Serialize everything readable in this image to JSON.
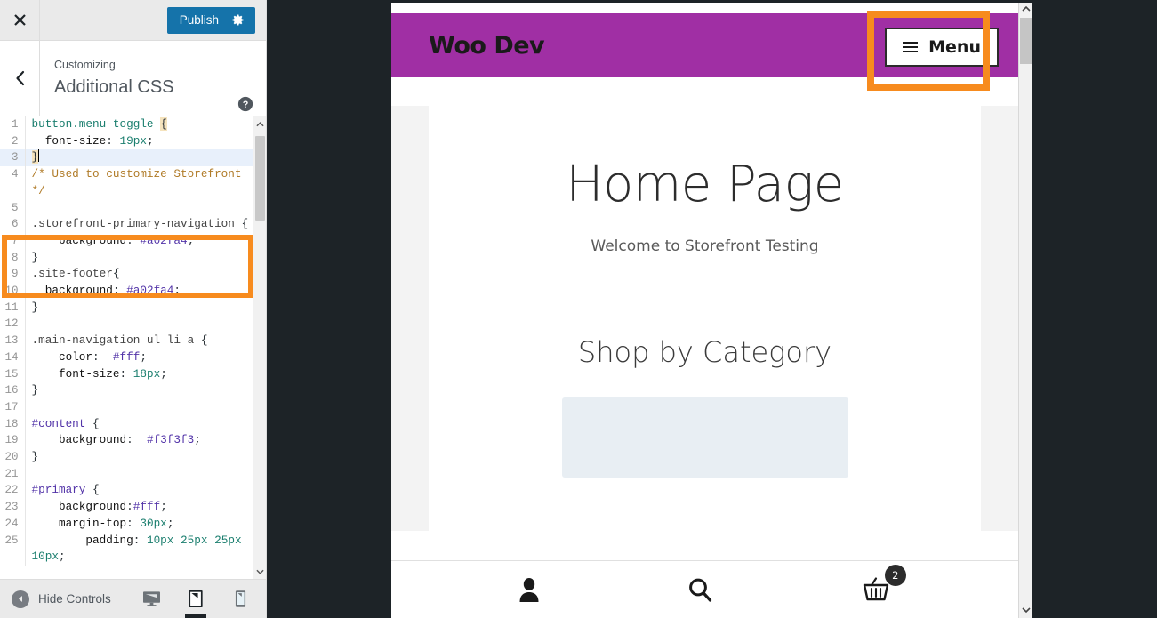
{
  "customizer": {
    "close_icon": "close-x-icon",
    "publish_label": "Publish",
    "gear_icon": "gear-icon",
    "back_icon": "chevron-left-icon",
    "breadcrumb": "Customizing",
    "panel_title": "Additional CSS",
    "help_icon": "help-circle-icon",
    "footer": {
      "hide_controls_label": "Hide Controls",
      "collapse_icon": "collapse-arrow-icon",
      "devices": [
        {
          "name": "desktop-preview",
          "icon": "desktop-icon",
          "active": false
        },
        {
          "name": "tablet-preview",
          "icon": "tablet-icon",
          "active": true
        },
        {
          "name": "mobile-preview",
          "icon": "mobile-icon",
          "active": false
        }
      ]
    }
  },
  "editor": {
    "lines": [
      {
        "n": "1",
        "text": "button.menu-toggle {"
      },
      {
        "n": "2",
        "text": "  font-size: 19px;"
      },
      {
        "n": "3",
        "text": "}"
      },
      {
        "n": "4",
        "text": "/* Used to customize Storefront*/"
      },
      {
        "n": "5",
        "text": ""
      },
      {
        "n": "6",
        "text": ".storefront-primary-navigation {"
      },
      {
        "n": "7",
        "text": "    background: #a02fa4;"
      },
      {
        "n": "8",
        "text": "}"
      },
      {
        "n": "9",
        "text": ".site-footer{"
      },
      {
        "n": "10",
        "text": "  background: #a02fa4;"
      },
      {
        "n": "11",
        "text": "}"
      },
      {
        "n": "12",
        "text": ""
      },
      {
        "n": "13",
        "text": ".main-navigation ul li a {"
      },
      {
        "n": "14",
        "text": "    color:  #fff;"
      },
      {
        "n": "15",
        "text": "    font-size: 18px;"
      },
      {
        "n": "16",
        "text": "}"
      },
      {
        "n": "17",
        "text": ""
      },
      {
        "n": "18",
        "text": "#content {"
      },
      {
        "n": "19",
        "text": "    background:  #f3f3f3;"
      },
      {
        "n": "20",
        "text": "}"
      },
      {
        "n": "21",
        "text": ""
      },
      {
        "n": "22",
        "text": "#primary {"
      },
      {
        "n": "23",
        "text": "    background:#fff;"
      },
      {
        "n": "24",
        "text": "    margin-top: 30px;"
      },
      {
        "n": "25",
        "text": "        padding: 10px 25px 25px 10px;"
      }
    ]
  },
  "preview": {
    "site_title": "Woo Dev",
    "menu_label": "Menu",
    "menu_icon": "hamburger-icon",
    "page_title": "Home Page",
    "page_subtitle": "Welcome to Storefront Testing",
    "category_heading": "Shop by Category",
    "footer_icons": [
      {
        "name": "account-icon",
        "label": ""
      },
      {
        "name": "search-icon",
        "label": ""
      },
      {
        "name": "cart-icon",
        "label": ""
      }
    ],
    "cart_count": "2"
  },
  "colors": {
    "brand_purple": "#a02fa4",
    "highlight_orange": "#f78b1e",
    "publish_blue": "#1573aa",
    "admin_dark": "#1d2327"
  }
}
